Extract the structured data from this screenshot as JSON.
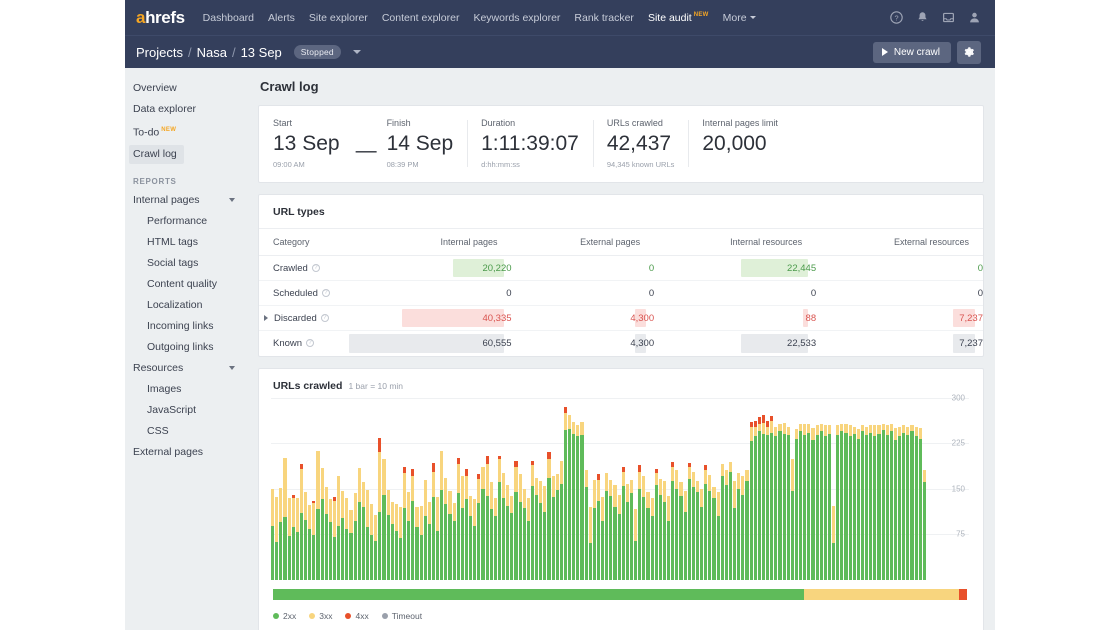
{
  "topnav": {
    "logo": "ahrefs",
    "items": [
      {
        "label": "Dashboard",
        "active": false
      },
      {
        "label": "Alerts",
        "active": false
      },
      {
        "label": "Site explorer",
        "active": false
      },
      {
        "label": "Content explorer",
        "active": false
      },
      {
        "label": "Keywords explorer",
        "active": false
      },
      {
        "label": "Rank tracker",
        "active": false
      },
      {
        "label": "Site audit",
        "active": true,
        "badge": "NEW"
      },
      {
        "label": "More",
        "active": false,
        "caret": true
      }
    ],
    "icons": [
      "help-icon",
      "bell-icon",
      "inbox-icon",
      "user-icon"
    ]
  },
  "breadcrumb": {
    "root": "Projects",
    "project": "Nasa",
    "crawl": "13 Sep",
    "sep": "/",
    "status": "Stopped",
    "new_crawl_label": "New crawl",
    "settings_icon": "gear-icon"
  },
  "sidebar": {
    "top_items": [
      {
        "label": "Overview",
        "active": false
      },
      {
        "label": "Data explorer",
        "active": false
      },
      {
        "label": "To-do",
        "active": false,
        "badge": "NEW"
      },
      {
        "label": "Crawl log",
        "active": true
      }
    ],
    "reports_header": "REPORTS",
    "groups": [
      {
        "label": "Internal pages",
        "expanded": true,
        "children": [
          "Performance",
          "HTML tags",
          "Social tags",
          "Content quality",
          "Localization",
          "Incoming links",
          "Outgoing links"
        ]
      },
      {
        "label": "Resources",
        "expanded": true,
        "children": [
          "Images",
          "JavaScript",
          "CSS"
        ]
      }
    ],
    "bottom_items": [
      {
        "label": "External pages",
        "active": false
      }
    ]
  },
  "main": {
    "page_title": "Crawl log",
    "stats": [
      {
        "label": "Start",
        "value": "13 Sep",
        "sub": "09:00 AM"
      },
      {
        "label": "Finish",
        "value": "14 Sep",
        "sub": "08:39 PM"
      },
      {
        "label": "Duration",
        "value": "1:11:39:07",
        "sub": "d:hh:mm:ss"
      },
      {
        "label": "URLs crawled",
        "value": "42,437",
        "sub": "94,345 known URLs"
      },
      {
        "label": "Internal pages limit",
        "value": "20,000",
        "sub": ""
      }
    ],
    "stat_separator": "—",
    "url_types": {
      "title": "URL types",
      "columns": [
        "Category",
        "Internal pages",
        "External pages",
        "Internal resources",
        "External resources"
      ],
      "rows": [
        {
          "category": "Crawled",
          "expandable": false,
          "tone": "green",
          "cells": [
            {
              "text": "20,220",
              "fill_pct": 33
            },
            {
              "text": "0",
              "fill_pct": 0
            },
            {
              "text": "22,445",
              "fill_pct": 37
            },
            {
              "text": "0",
              "fill_pct": 0
            }
          ]
        },
        {
          "category": "Scheduled",
          "expandable": false,
          "tone": "plain",
          "cells": [
            {
              "text": "0",
              "fill_pct": 0
            },
            {
              "text": "0",
              "fill_pct": 0
            },
            {
              "text": "0",
              "fill_pct": 0
            },
            {
              "text": "0",
              "fill_pct": 0
            }
          ]
        },
        {
          "category": "Discarded",
          "expandable": true,
          "tone": "red",
          "cells": [
            {
              "text": "40,335",
              "fill_pct": 66
            },
            {
              "text": "4,300",
              "fill_pct": 7
            },
            {
              "text": "88",
              "fill_pct": 1
            },
            {
              "text": "7,237",
              "fill_pct": 12
            }
          ]
        },
        {
          "category": "Known",
          "expandable": false,
          "tone": "gray",
          "cells": [
            {
              "text": "60,555",
              "fill_pct": 100
            },
            {
              "text": "4,300",
              "fill_pct": 7
            },
            {
              "text": "22,533",
              "fill_pct": 37
            },
            {
              "text": "7,237",
              "fill_pct": 12
            }
          ]
        }
      ]
    }
  },
  "colors": {
    "header_navy": "#343f5c",
    "accent_orange": "#f5a623",
    "green_2xx": "#5fbb5a",
    "yellow_3xx": "#f8d57e",
    "red_4xx": "#e8502a",
    "gray_timeout": "#9aa0ab",
    "page_bg": "#eceff1"
  },
  "chart_data": {
    "type": "bar",
    "title": "URLs crawled",
    "subtitle": "1 bar = 10 min",
    "stacked": true,
    "xlabel": "",
    "ylabel": "",
    "ylim": [
      0,
      300
    ],
    "yticks": [
      75,
      150,
      225,
      300
    ],
    "grid": true,
    "legend_position": "bottom",
    "legend": [
      "2xx",
      "3xx",
      "4xx",
      "Timeout"
    ],
    "series": [
      {
        "name": "2xx",
        "color": "#5fbb5a",
        "values": [
          88,
          62,
          95,
          103,
          72,
          86,
          78,
          110,
          98,
          83,
          74,
          116,
          132,
          108,
          95,
          70,
          88,
          102,
          84,
          77,
          96,
          128,
          120,
          86,
          74,
          64,
          112,
          140,
          106,
          92,
          80,
          68,
          118,
          96,
          130,
          86,
          74,
          104,
          92,
          136,
          80,
          148,
          124,
          108,
          96,
          142,
          118,
          132,
          104,
          88,
          126,
          150,
          138,
          116,
          104,
          160,
          134,
          122,
          110,
          145,
          128,
          118,
          96,
          154,
          140,
          126,
          112,
          168,
          136,
          148,
          158,
          246,
          248,
          240,
          236,
          238,
          152,
          60,
          118,
          130,
          96,
          146,
          138,
          120,
          108,
          154,
          128,
          142,
          64,
          150,
          136,
          118,
          104,
          156,
          140,
          128,
          96,
          162,
          150,
          138,
          112,
          166,
          152,
          144,
          120,
          158,
          146,
          134,
          104,
          170,
          156,
          178,
          118,
          150,
          140,
          162,
          228,
          236,
          244,
          240,
          238,
          242,
          236,
          244,
          240,
          238,
          146,
          232,
          244,
          238,
          242,
          230,
          238,
          244,
          236,
          240,
          60,
          238,
          244,
          242,
          236,
          240,
          232,
          244,
          238,
          242,
          236,
          240,
          246,
          238,
          244,
          230,
          236,
          242,
          238,
          244,
          236,
          232,
          160
        ],
        "unit": "URLs per 10 min"
      },
      {
        "name": "3xx",
        "color": "#f8d57e",
        "values": [
          62,
          74,
          56,
          98,
          62,
          48,
          56,
          72,
          46,
          40,
          52,
          96,
          52,
          44,
          38,
          60,
          82,
          44,
          50,
          38,
          46,
          56,
          40,
          62,
          50,
          42,
          98,
          58,
          42,
          36,
          44,
          52,
          58,
          48,
          40,
          34,
          48,
          60,
          36,
          42,
          56,
          64,
          44,
          38,
          30,
          48,
          52,
          38,
          34,
          44,
          40,
          36,
          52,
          44,
          30,
          38,
          42,
          34,
          28,
          40,
          46,
          32,
          38,
          34,
          28,
          36,
          42,
          30,
          34,
          26,
          38,
          28,
          24,
          20,
          18,
          22,
          28,
          60,
          46,
          34,
          40,
          30,
          26,
          36,
          32,
          24,
          30,
          22,
          52,
          28,
          34,
          26,
          30,
          20,
          26,
          34,
          42,
          24,
          30,
          22,
          34,
          20,
          26,
          18,
          30,
          22,
          26,
          18,
          40,
          20,
          24,
          16,
          44,
          26,
          30,
          18,
          24,
          16,
          12,
          18,
          14,
          20,
          16,
          12,
          18,
          14,
          52,
          16,
          12,
          18,
          14,
          20,
          16,
          12,
          18,
          14,
          62,
          16,
          12,
          14,
          18,
          12,
          16,
          10,
          14,
          12,
          18,
          14,
          10,
          16,
          12,
          20,
          16,
          12,
          14,
          10,
          16,
          18,
          20
        ],
        "unit": "URLs per 10 min"
      },
      {
        "name": "4xx",
        "color": "#e8502a",
        "values": [
          0,
          0,
          0,
          0,
          0,
          6,
          0,
          8,
          0,
          0,
          4,
          0,
          0,
          0,
          0,
          6,
          0,
          0,
          0,
          0,
          0,
          0,
          0,
          0,
          0,
          0,
          24,
          0,
          0,
          0,
          0,
          0,
          10,
          0,
          12,
          0,
          0,
          0,
          0,
          14,
          0,
          0,
          0,
          0,
          0,
          10,
          0,
          12,
          0,
          0,
          8,
          0,
          14,
          0,
          0,
          6,
          0,
          0,
          0,
          10,
          0,
          0,
          0,
          8,
          0,
          0,
          0,
          12,
          0,
          0,
          0,
          10,
          0,
          0,
          0,
          0,
          0,
          0,
          0,
          10,
          0,
          0,
          0,
          0,
          0,
          8,
          0,
          0,
          0,
          10,
          0,
          0,
          0,
          6,
          0,
          0,
          0,
          8,
          0,
          0,
          0,
          6,
          0,
          0,
          0,
          8,
          0,
          0,
          0,
          0,
          0,
          0,
          0,
          0,
          0,
          0,
          8,
          10,
          12,
          14,
          10,
          8,
          0,
          0,
          0,
          0,
          0,
          0,
          0,
          0,
          0,
          0,
          0,
          0,
          0,
          0,
          0,
          0,
          0,
          0,
          0,
          0,
          0,
          0,
          0,
          0,
          0,
          0,
          0,
          0,
          0,
          0,
          0,
          0,
          0,
          0,
          0,
          0,
          0
        ],
        "unit": "URLs per 10 min"
      },
      {
        "name": "Timeout",
        "color": "#9aa0ab",
        "values": [],
        "unit": "URLs per 10 min"
      }
    ],
    "summary_bar": [
      {
        "name": "2xx",
        "pct": 76.5,
        "color": "#5fbb5a"
      },
      {
        "name": "3xx",
        "pct": 22.3,
        "color": "#f8d57e"
      },
      {
        "name": "4xx",
        "pct": 1.2,
        "color": "#e8502a"
      }
    ]
  }
}
